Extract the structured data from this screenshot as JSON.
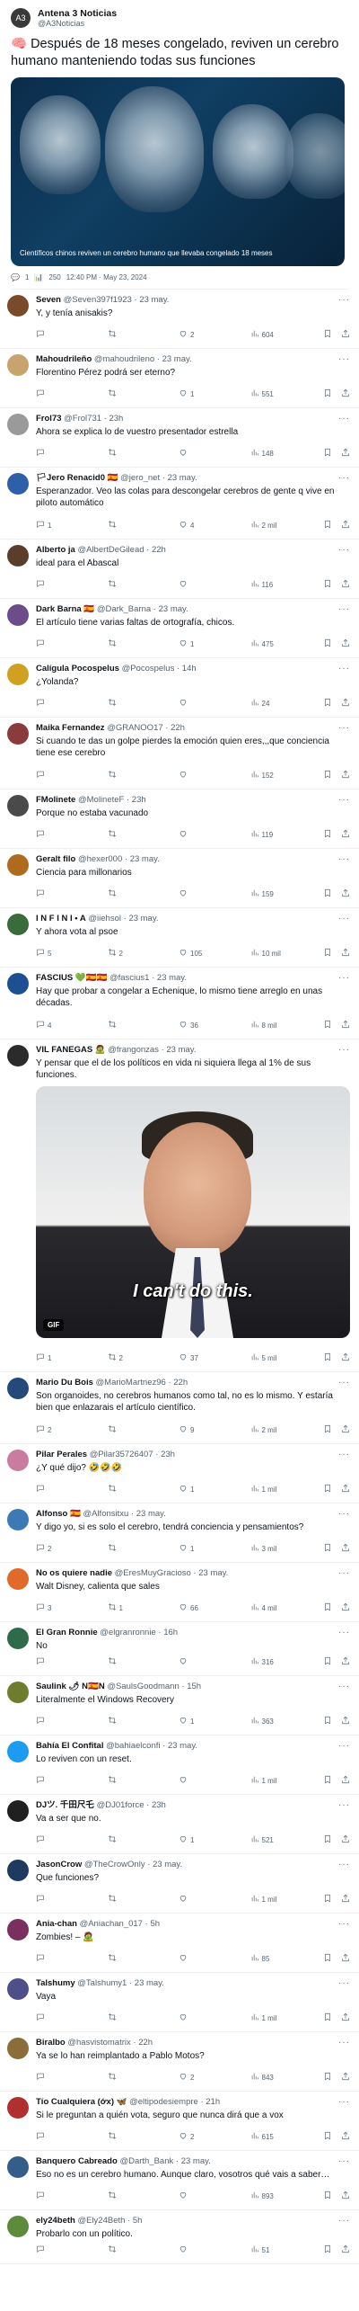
{
  "post": {
    "author_name": "Antena 3 Noticias",
    "author_handle": "@A3Noticias",
    "text": "🧠 Después de 18 meses congelado, reviven un cerebro humano manteniendo todas sus funciones",
    "image_caption": "Científicos chinos reviven un cerebro humano que llevaba congelado 18 meses",
    "meta": {
      "replies": "1",
      "views": "250",
      "time": "12:40 PM · May 23, 2024"
    }
  },
  "replies": [
    {
      "name": "Seven",
      "handle": "@Seven397f1923",
      "time": "23 may.",
      "text": "Y, y tenía anisakis?",
      "reply": "",
      "rt": "",
      "like": "2",
      "views": "604",
      "avatar_color": "#7a4b2a",
      "height": 66
    },
    {
      "name": "Mahoudrileño",
      "handle": "@mahoudrileno",
      "time": "23 may.",
      "text": "Florentino Pérez podrá ser eterno?",
      "reply": "",
      "rt": "",
      "like": "1",
      "views": "551",
      "avatar_color": "#c8a36d",
      "height": 66
    },
    {
      "name": "Frol73",
      "handle": "@Frol731",
      "time": "23h",
      "text": "Ahora se explica lo de vuestro presentador estrella",
      "reply": "",
      "rt": "",
      "like": "",
      "views": "148",
      "avatar_color": "#9a9a9a",
      "height": 66
    },
    {
      "name": "🏳Jero Renacid0 🇪🇸",
      "handle": "@jero_net",
      "time": "23 may.",
      "text": "Esperanzador. Veo las colas para descongelar cerebros de gente q vive en piloto automático",
      "reply": "1",
      "rt": "",
      "like": "4",
      "views": "2 mil",
      "avatar_color": "#2e5fa7",
      "height": 80
    },
    {
      "name": "Alberto ja",
      "handle": "@AlbertDeGilead",
      "time": "22h",
      "text": "ideal para el Abascal",
      "reply": "",
      "rt": "",
      "like": "",
      "views": "116",
      "avatar_color": "#5a3e2b",
      "height": 66
    },
    {
      "name": "Dark Barna 🇪🇸",
      "handle": "@Dark_Barna",
      "time": "23 may.",
      "text": "El artículo tiene varias faltas de ortografía, chicos.",
      "reply": "",
      "rt": "",
      "like": "1",
      "views": "475",
      "avatar_color": "#6b4d8a",
      "height": 66
    },
    {
      "name": "Calígula Pocospelus",
      "handle": "@Pocospelus",
      "time": "14h",
      "text": "¿Yolanda?",
      "reply": "",
      "rt": "",
      "like": "",
      "views": "24",
      "avatar_color": "#d0a020",
      "height": 66
    },
    {
      "name": "Maika Fernandez",
      "handle": "@GRANOO17",
      "time": "22h",
      "text": "Si cuando te das un golpe pierdes la emoción quien eres,,,que conciencia tiene ese cerebro",
      "reply": "",
      "rt": "",
      "like": "",
      "views": "152",
      "avatar_color": "#8a3c3c",
      "height": 80
    },
    {
      "name": "FMolinete",
      "handle": "@MolineteF",
      "time": "23h",
      "text": "Porque no estaba vacunado",
      "reply": "",
      "rt": "",
      "like": "",
      "views": "119",
      "avatar_color": "#4a4a4a",
      "height": 66
    },
    {
      "name": "Geralt filo",
      "handle": "@hexer000",
      "time": "23 may.",
      "text": "Ciencia para millonarios",
      "reply": "",
      "rt": "",
      "like": "",
      "views": "159",
      "avatar_color": "#b06a1e",
      "height": 66
    },
    {
      "name": "I N F I N I • A",
      "handle": "@iiehsol",
      "time": "23 may.",
      "text": "Y ahora vota al psoe",
      "reply": "5",
      "rt": "2",
      "like": "105",
      "views": "10 mil",
      "avatar_color": "#3a6b3a",
      "height": 66
    },
    {
      "name": "FASCIUS 💚🇪🇸🇪🇸",
      "handle": "@fascius1",
      "time": "23 may.",
      "text": "Hay que probar a congelar a Echenique, lo mismo tiene arreglo en unas décadas.",
      "reply": "4",
      "rt": "",
      "like": "36",
      "views": "8 mil",
      "avatar_color": "#1d4f91",
      "height": 80
    }
  ],
  "gif_reply": {
    "name": "VIL FANEGAS 🧟",
    "handle": "@frangonzas",
    "time": "23 may.",
    "text": "Y pensar que el de los políticos en vida ni siquiera llega al 1% de sus funciones.",
    "subtitle": "I can't do this.",
    "gif_label": "GIF",
    "reply": "1",
    "rt": "2",
    "like": "37",
    "views": "5 mil",
    "avatar_color": "#2b2b2b"
  },
  "replies2": [
    {
      "name": "Mario Du Bois",
      "handle": "@MarioMartnez96",
      "time": "22h",
      "text": "Son organoides, no cerebros humanos como tal, no es lo mismo. Y estaría bien que enlazarais el artículo científico.",
      "reply": "2",
      "rt": "",
      "like": "9",
      "views": "2 mil",
      "avatar_color": "#234a7a",
      "height": 80
    },
    {
      "name": "Pilar Perales",
      "handle": "@Pilar35726407",
      "time": "23h",
      "text": "¿Y qué dijo? 🤣🤣🤣",
      "reply": "",
      "rt": "",
      "like": "1",
      "views": "1 mil",
      "avatar_color": "#c97ba0",
      "height": 66
    },
    {
      "name": "Alfonso 🇪🇸",
      "handle": "@Alfonsitxu",
      "time": "23 may.",
      "text": "Y digo yo, si es solo el cerebro, tendrá conciencia y pensamientos?",
      "reply": "2",
      "rt": "",
      "like": "1",
      "views": "3 mil",
      "avatar_color": "#3b7ab5",
      "height": 66
    },
    {
      "name": "No os quiere nadie",
      "handle": "@EresMuyGracioso",
      "time": "23 may.",
      "text": "Walt Disney, calienta que sales",
      "reply": "3",
      "rt": "1",
      "like": "66",
      "views": "4 mil",
      "avatar_color": "#e06a2b",
      "height": 66
    },
    {
      "name": "El Gran Ronnie",
      "handle": "@elgranronnie",
      "time": "16h",
      "text": "No",
      "reply": "",
      "rt": "",
      "like": "",
      "views": "316",
      "avatar_color": "#2f6b4a",
      "height": 60
    },
    {
      "name": "Saulink 🌶 N🇪🇸N",
      "handle": "@SaulsGoodmann",
      "time": "15h",
      "text": "Literalmente el Windows Recovery",
      "reply": "",
      "rt": "",
      "like": "1",
      "views": "363",
      "avatar_color": "#6e7d2d",
      "height": 66
    },
    {
      "name": "Bahía El Confital",
      "handle": "@bahiaelconfi",
      "time": "23 may.",
      "text": "Lo reviven con un reset.",
      "reply": "",
      "rt": "",
      "like": "",
      "views": "1 mil",
      "avatar_color": "#1d9bf0",
      "height": 66
    },
    {
      "name": "DJツ. 千田尺乇",
      "handle": "@DJ01force",
      "time": "23h",
      "text": "Va a ser que no.",
      "reply": "",
      "rt": "",
      "like": "1",
      "views": "521",
      "avatar_color": "#202020",
      "height": 66
    },
    {
      "name": "JasonCrow",
      "handle": "@TheCrowOnly",
      "time": "23 may.",
      "text": "Que funciones?",
      "reply": "",
      "rt": "",
      "like": "",
      "views": "1 mil",
      "avatar_color": "#1e3a5f",
      "height": 66
    },
    {
      "name": "Ania-chan",
      "handle": "@Aniachan_017",
      "time": "5h",
      "text": "Zombies! – 🧟",
      "reply": "",
      "rt": "",
      "like": "",
      "views": "85",
      "avatar_color": "#7a2f5f",
      "height": 66
    },
    {
      "name": "Talshumy",
      "handle": "@Talshumy1",
      "time": "23 may.",
      "text": "Vaya",
      "reply": "",
      "rt": "",
      "like": "",
      "views": "1 mil",
      "avatar_color": "#4f4f8a",
      "height": 66
    },
    {
      "name": "Biralbo",
      "handle": "@hasvistomatrix",
      "time": "22h",
      "text": "Ya se lo han reimplantado a Pablo Motos?",
      "reply": "",
      "rt": "",
      "like": "2",
      "views": "843",
      "avatar_color": "#8a6d3b",
      "height": 66
    },
    {
      "name": "Tío Cualquiera (ớх) 🦋",
      "handle": "@eltipodesiempre",
      "time": "21h",
      "text": "Si le preguntan a quién vota, seguro que nunca dirá que a vox",
      "reply": "",
      "rt": "",
      "like": "2",
      "views": "615",
      "avatar_color": "#b03030",
      "height": 66
    },
    {
      "name": "Banquero Cabreado",
      "handle": "@Darth_Bank",
      "time": "23 may.",
      "text": "Eso no es un cerebro humano. Aunque claro, vosotros qué vais a saber…",
      "reply": "",
      "rt": "",
      "like": "",
      "views": "893",
      "avatar_color": "#355d8a",
      "height": 66
    },
    {
      "name": "ely24beth",
      "handle": "@Ely24Beth",
      "time": "5h",
      "text": "Probarlo con un político.",
      "reply": "",
      "rt": "",
      "like": "",
      "views": "51",
      "avatar_color": "#5d8a3b",
      "height": 60
    }
  ]
}
